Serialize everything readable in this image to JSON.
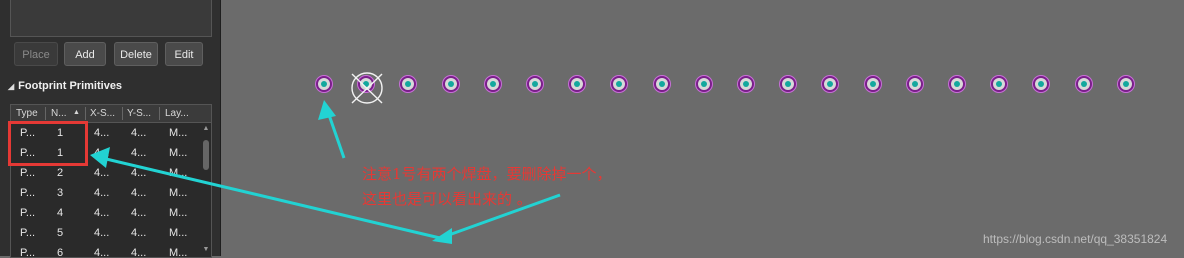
{
  "panel": {
    "buttons": {
      "place": "Place",
      "add": "Add",
      "delete": "Delete",
      "edit": "Edit"
    },
    "section_title": "Footprint Primitives",
    "table": {
      "headers": [
        "Type",
        "N...",
        "X-S...",
        "Y-S...",
        "Lay..."
      ],
      "rows": [
        [
          "P...",
          "1",
          "4...",
          "4...",
          "M..."
        ],
        [
          "P...",
          "1",
          "4...",
          "4...",
          "M..."
        ],
        [
          "P...",
          "2",
          "4...",
          "4...",
          "M..."
        ],
        [
          "P...",
          "3",
          "4...",
          "4...",
          "M..."
        ],
        [
          "P...",
          "4",
          "4...",
          "4...",
          "M..."
        ],
        [
          "P...",
          "5",
          "4...",
          "4...",
          "M..."
        ],
        [
          "P...",
          "6",
          "4...",
          "4...",
          "M..."
        ]
      ]
    }
  },
  "canvas": {
    "pad_count": 20,
    "annotation": {
      "line1": "注意1号有两个焊盘，要删除掉一个，",
      "line2": "这里也是可以看出来的 。"
    },
    "watermark": "https://blog.csdn.net/qq_38351824"
  },
  "colors": {
    "canvas_bg": "#6b6b6b",
    "panel_bg": "#2f2f2f",
    "pad_ring": "#7a1f8a",
    "pad_hole": "#13a89e",
    "annotation_red": "#e53935",
    "arrow_cyan": "#22d3d3"
  }
}
